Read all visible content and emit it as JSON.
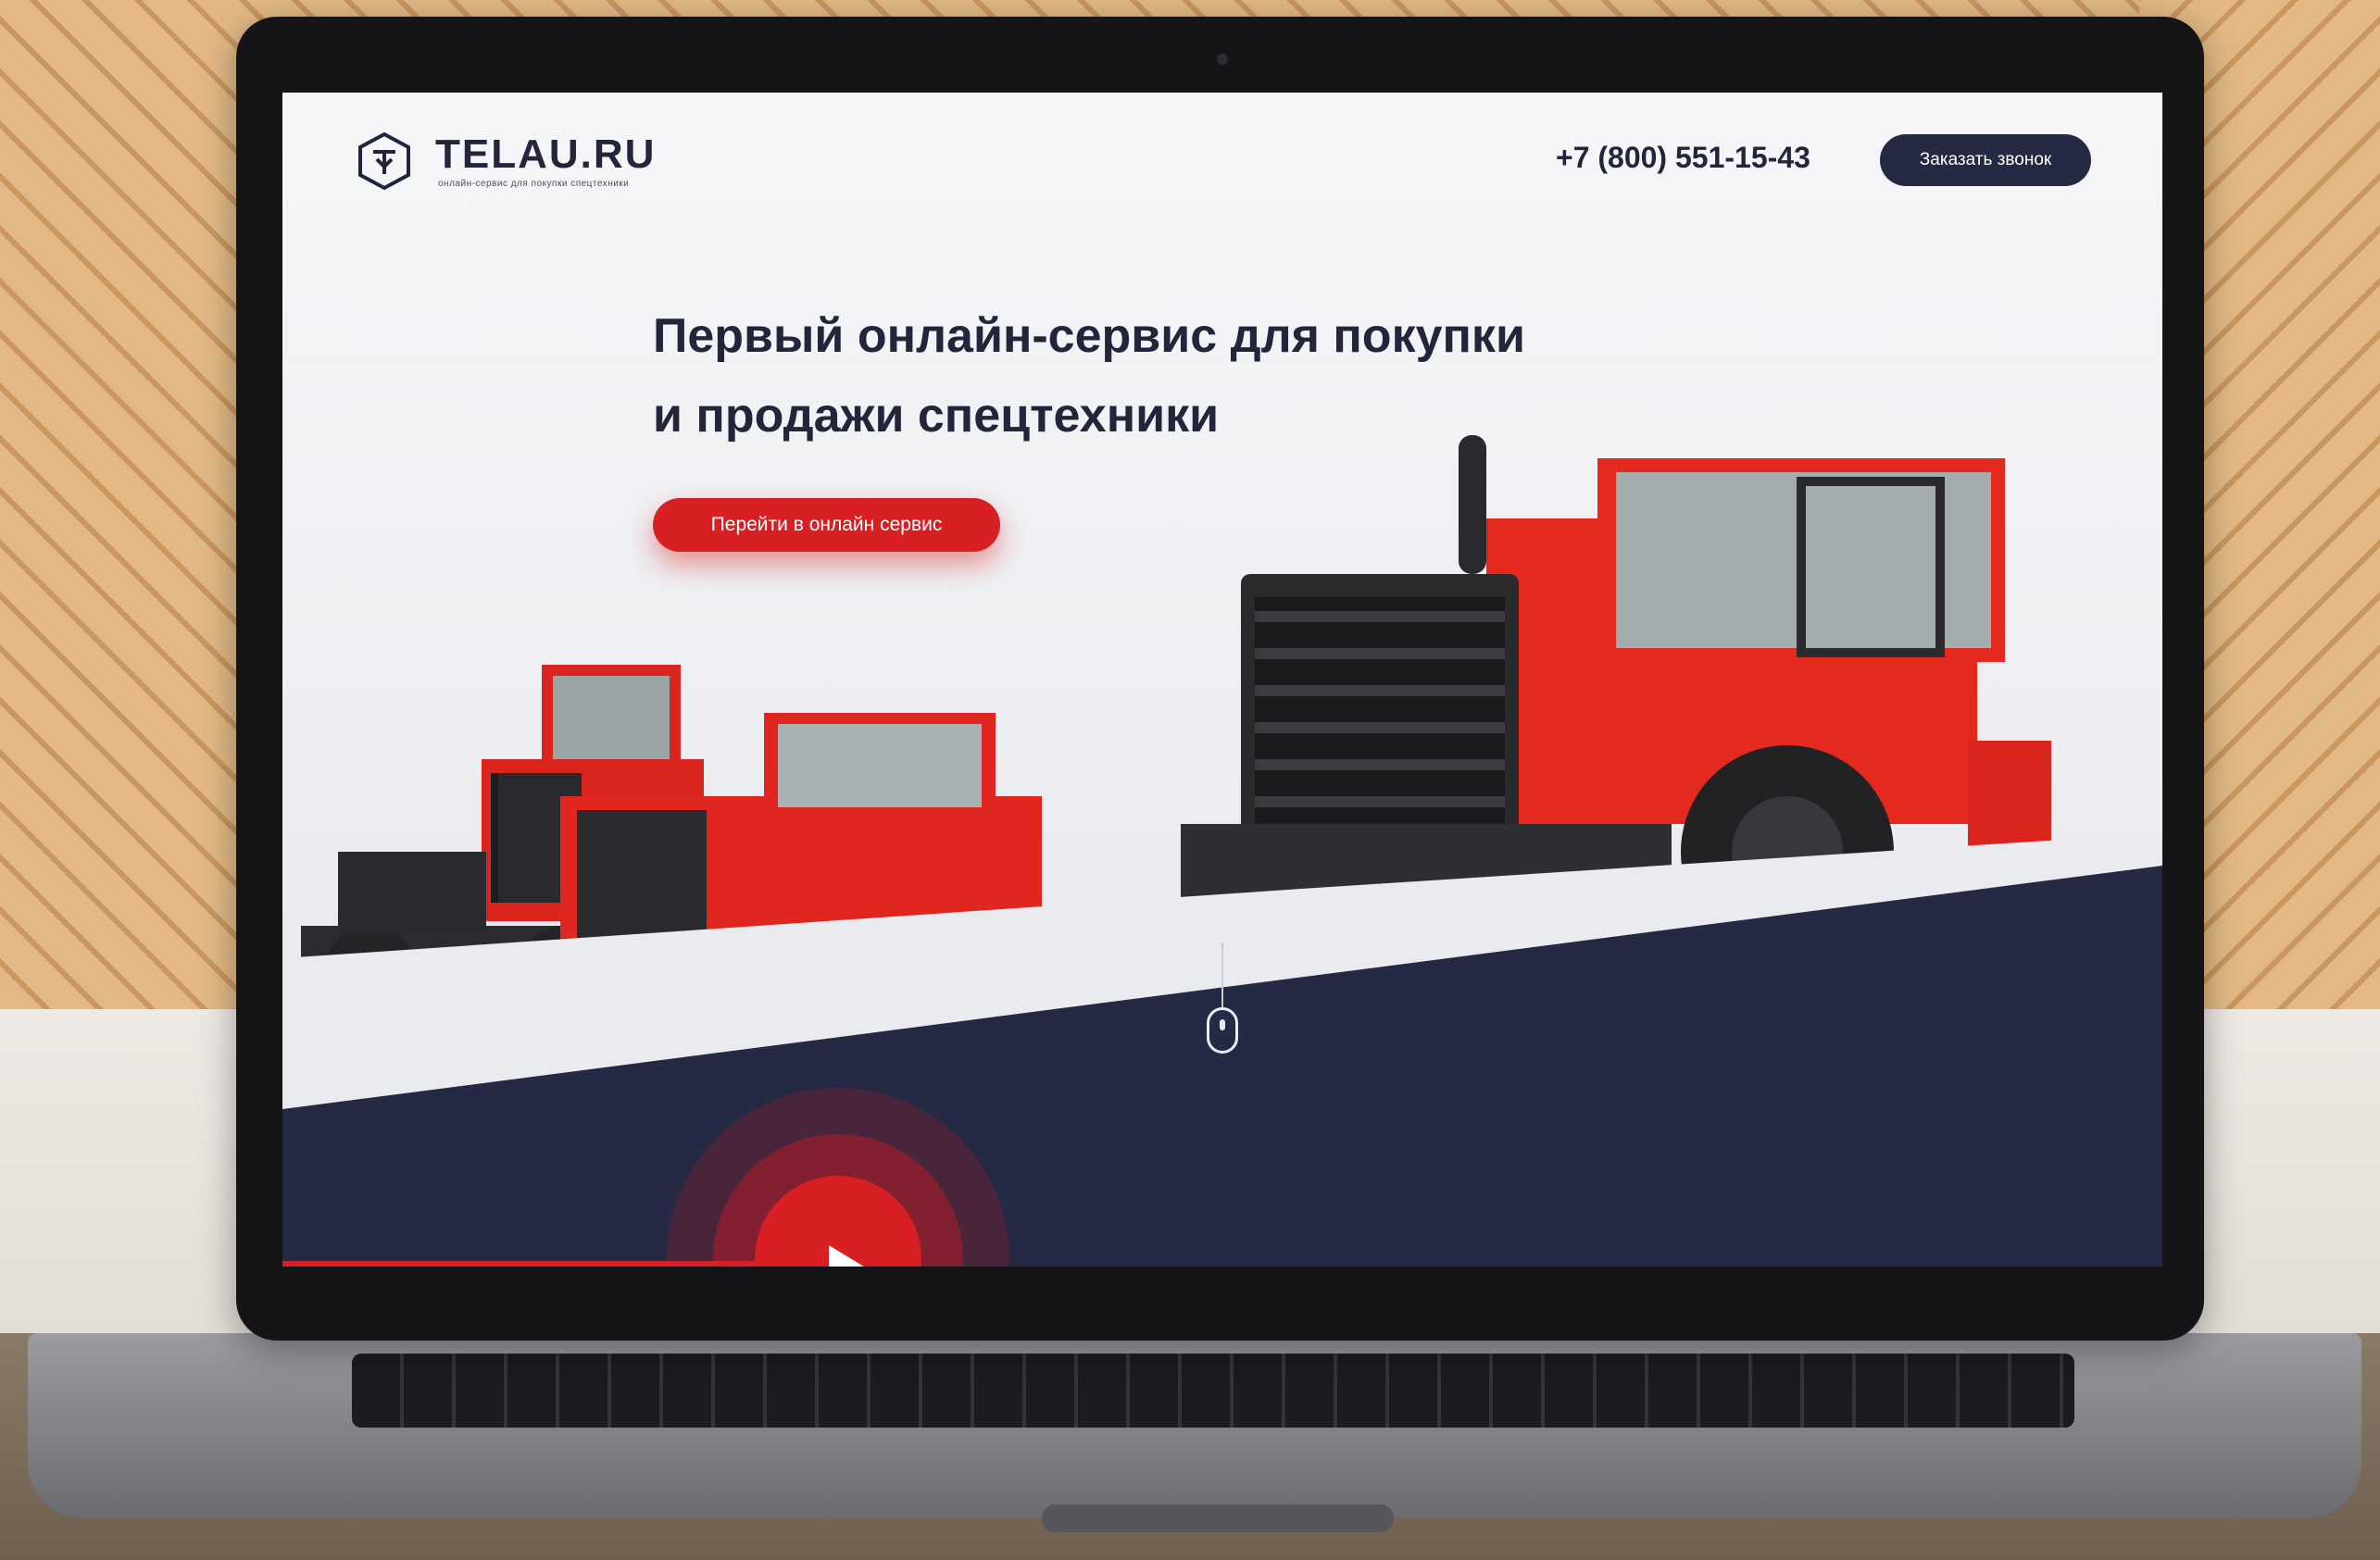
{
  "header": {
    "logo_text": "TELAU.RU",
    "logo_tagline": "онлайн-сервис для покупки спецтехники",
    "phone": "+7 (800) 551-15-43",
    "callback_label": "Заказать звонок"
  },
  "hero": {
    "title_line1": "Первый онлайн-сервис для покупки",
    "title_line2": "и продажи спецтехники",
    "cta_label": "Перейти в онлайн сервис"
  },
  "colors": {
    "brand_navy": "#262943",
    "accent_red": "#d81f24",
    "background": "#f6f6f8"
  },
  "icons": [
    "logo-mark-icon",
    "mouse-scroll-icon",
    "play-icon"
  ]
}
